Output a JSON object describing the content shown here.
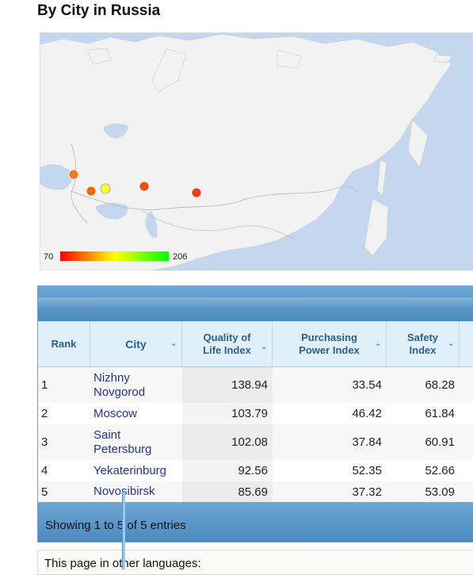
{
  "section_title": "By City in Russia",
  "map": {
    "legend": {
      "min_label": "70",
      "max_label": "206",
      "colors": [
        "#ff0000",
        "#ffff00",
        "#00ff00"
      ]
    },
    "ocean_color": "#c4d7ef",
    "land_color": "#f2f2f2",
    "markers": [
      {
        "city": "Saint Petersburg",
        "color": "#f07a1a"
      },
      {
        "city": "Moscow",
        "color": "#f06a10"
      },
      {
        "city": "Nizhny Novgorod",
        "color": "#ffff33"
      },
      {
        "city": "Yekaterinburg",
        "color": "#ee5010"
      },
      {
        "city": "Novosibirsk",
        "color": "#e84010"
      }
    ]
  },
  "table": {
    "columns": [
      "Rank",
      "City",
      "Quality of Life Index",
      "Purchasing Power Index",
      "Safety Index"
    ],
    "rows": [
      {
        "rank": "1",
        "city": "Nizhny Novgorod",
        "quality": "138.94",
        "purchasing": "33.54",
        "safety": "68.28"
      },
      {
        "rank": "2",
        "city": "Moscow",
        "quality": "103.79",
        "purchasing": "46.42",
        "safety": "61.84"
      },
      {
        "rank": "3",
        "city": "Saint Petersburg",
        "quality": "102.08",
        "purchasing": "37.84",
        "safety": "60.91"
      },
      {
        "rank": "4",
        "city": "Yekaterinburg",
        "quality": "92.56",
        "purchasing": "52.35",
        "safety": "52.66"
      },
      {
        "rank": "5",
        "city": "Novosibirsk",
        "quality": "85.69",
        "purchasing": "37.32",
        "safety": "53.09"
      }
    ],
    "info": "Showing 1 to 5 of 5 entries"
  },
  "other_languages_label": "This page in other languages:"
}
